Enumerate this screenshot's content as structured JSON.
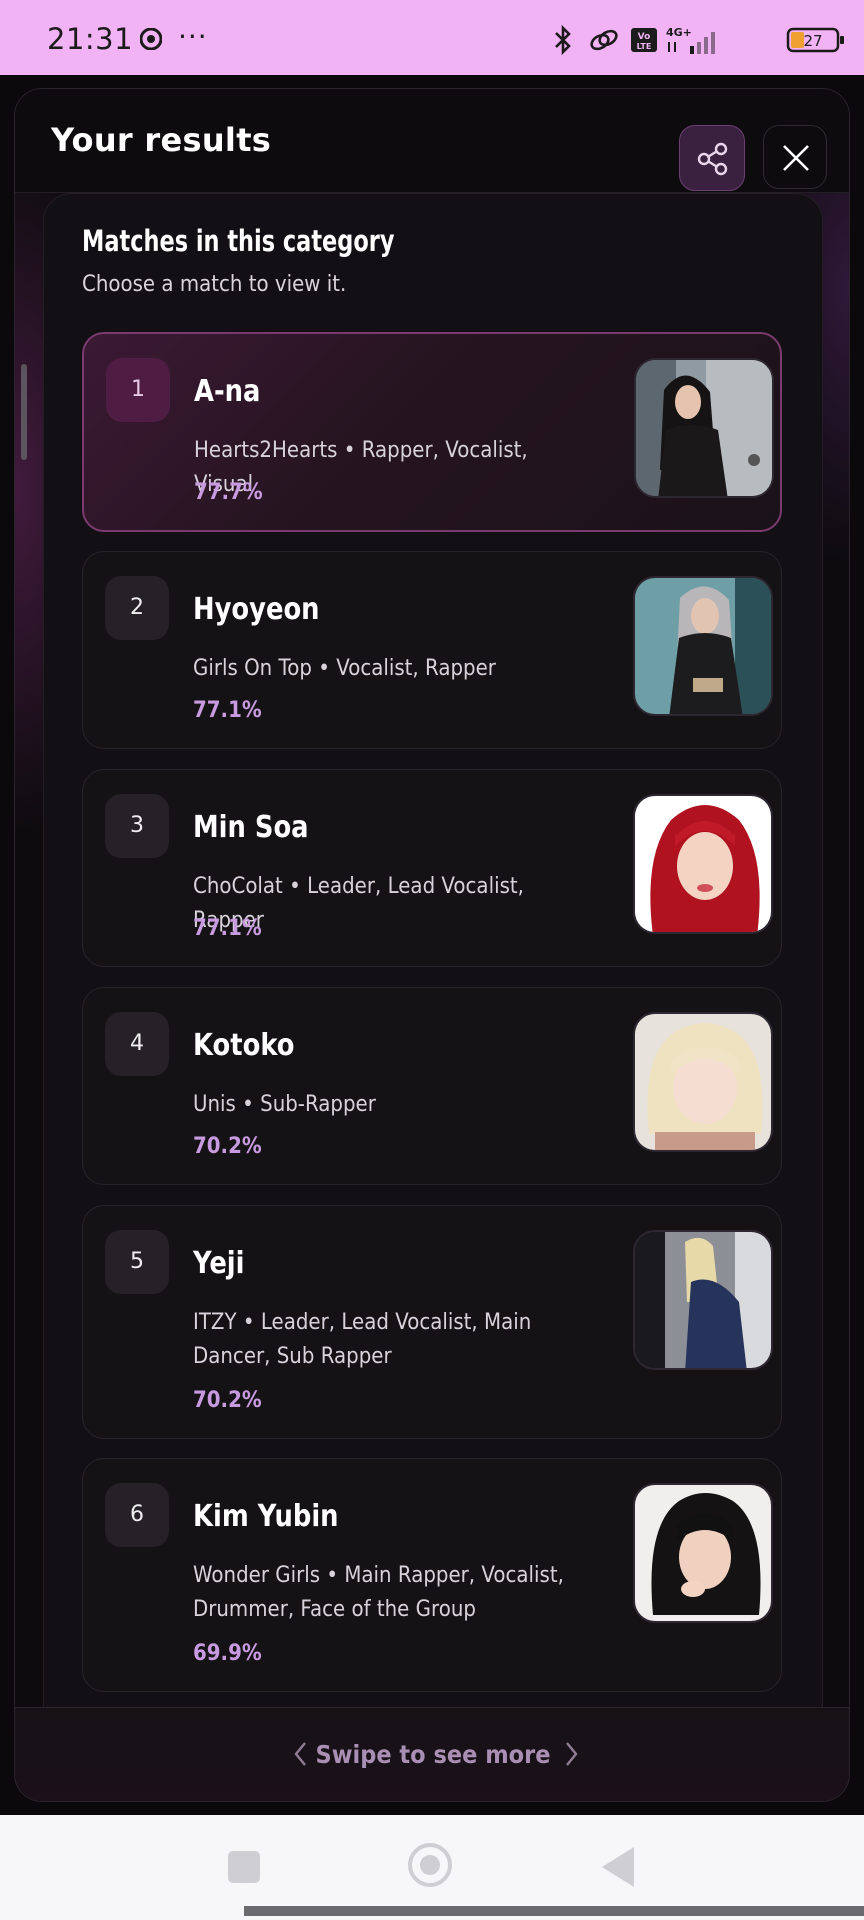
{
  "status_bar": {
    "time": "21:31",
    "more": "···",
    "battery": "27",
    "network": "4G+",
    "volte": "Vo LTE",
    "icons": [
      "chrome-icon",
      "bluetooth-icon",
      "link-icon",
      "volte-icon",
      "signal-icon",
      "battery-icon"
    ]
  },
  "header": {
    "title": "Your results",
    "share_icon": "share-icon",
    "close_icon": "close-icon"
  },
  "section": {
    "title": "Matches in this category",
    "subtitle": "Choose a match to view it."
  },
  "matches": [
    {
      "rank": "1",
      "name": "A-na",
      "desc": "Hearts2Hearts • Rapper, Vocalist, Visual",
      "pct": "77.7%",
      "selected": true
    },
    {
      "rank": "2",
      "name": "Hyoyeon",
      "desc": "Girls On Top • Vocalist, Rapper",
      "pct": "77.1%"
    },
    {
      "rank": "3",
      "name": "Min Soa",
      "desc": "ChoColat • Leader, Lead Vocalist, Rapper",
      "pct": "77.1%"
    },
    {
      "rank": "4",
      "name": "Kotoko",
      "desc": "Unis • Sub-Rapper",
      "pct": "70.2%"
    },
    {
      "rank": "5",
      "name": "Yeji",
      "desc": "ITZY • Leader, Lead Vocalist, Main Dancer, Sub Rapper",
      "pct": "70.2%"
    },
    {
      "rank": "6",
      "name": "Kim Yubin",
      "desc": "Wonder Girls • Main Rapper, Vocalist, Drummer, Face of the Group",
      "pct": "69.9%"
    }
  ],
  "footer": {
    "swipe_text": "Swipe to see more"
  },
  "colors": {
    "accent": "#c89ae0",
    "status_bar_bg": "#f2b3f5",
    "panel_bg": "#0d0b0e",
    "selected_border": "#7b3a6f"
  }
}
